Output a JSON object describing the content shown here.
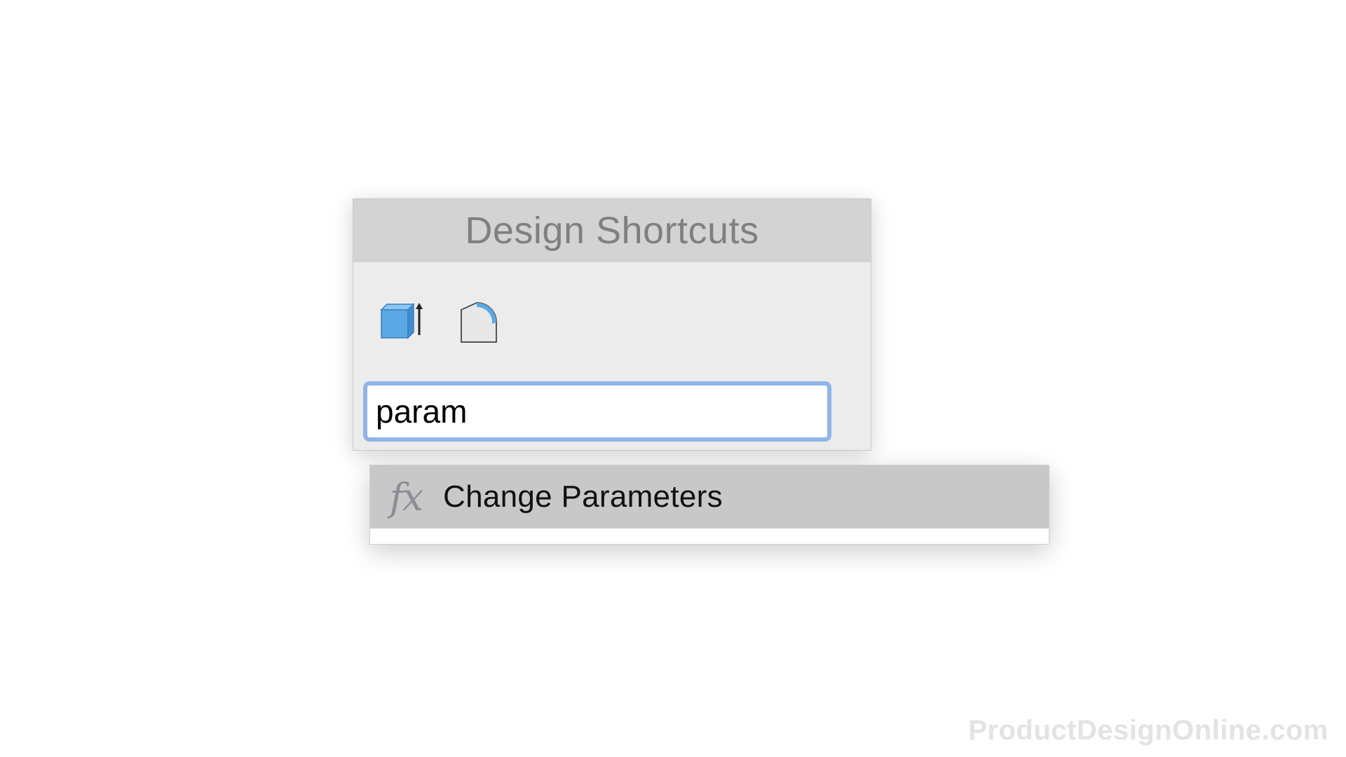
{
  "panel": {
    "title": "Design Shortcuts",
    "tools": [
      {
        "icon": "extrude-icon",
        "tooltip": "Extrude"
      },
      {
        "icon": "fillet-icon",
        "tooltip": "Fillet"
      }
    ]
  },
  "search": {
    "value": "param"
  },
  "results": [
    {
      "icon": "function-fx-icon",
      "icon_text": "fx",
      "label": "Change Parameters"
    }
  ],
  "watermark": "ProductDesignOnline.com",
  "colors": {
    "header_bg": "#d3d3d3",
    "panel_bg": "#ececec",
    "focus_ring": "#8fb5ea",
    "result_highlight": "#c8c8c8",
    "tool_blue": "#5aa9e6"
  }
}
